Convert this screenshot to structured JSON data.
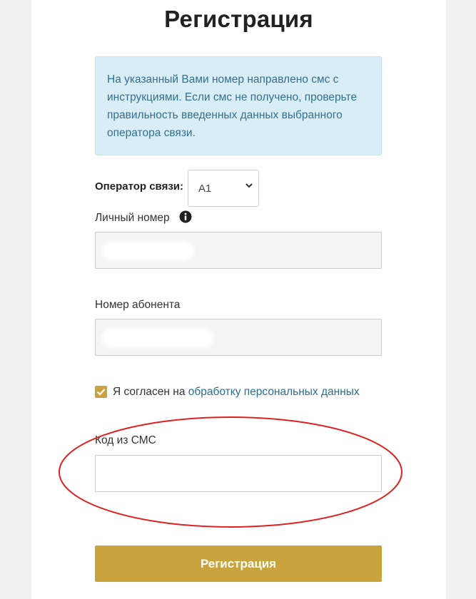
{
  "page_title": "Регистрация",
  "alert": {
    "text": "На указанный Вами номер направлено смс с инструкциями. Если смс не получено, проверьте правильность введенных данных выбранного оператора связи."
  },
  "operator": {
    "label": "Оператор связи:",
    "selected": "A1"
  },
  "personal_number": {
    "label": "Личный номер"
  },
  "subscriber_number": {
    "label": "Номер абонента"
  },
  "consent": {
    "checked": true,
    "text": "Я согласен на ",
    "link": "обработку персональных данных"
  },
  "sms_code": {
    "label": "Код из СМС",
    "value": ""
  },
  "submit_label": "Регистрация",
  "colors": {
    "accent": "#c9a43e",
    "alert_bg": "#d9edf7",
    "alert_text": "#31708f",
    "link": "#2a6f93",
    "annotation": "#e02020"
  }
}
